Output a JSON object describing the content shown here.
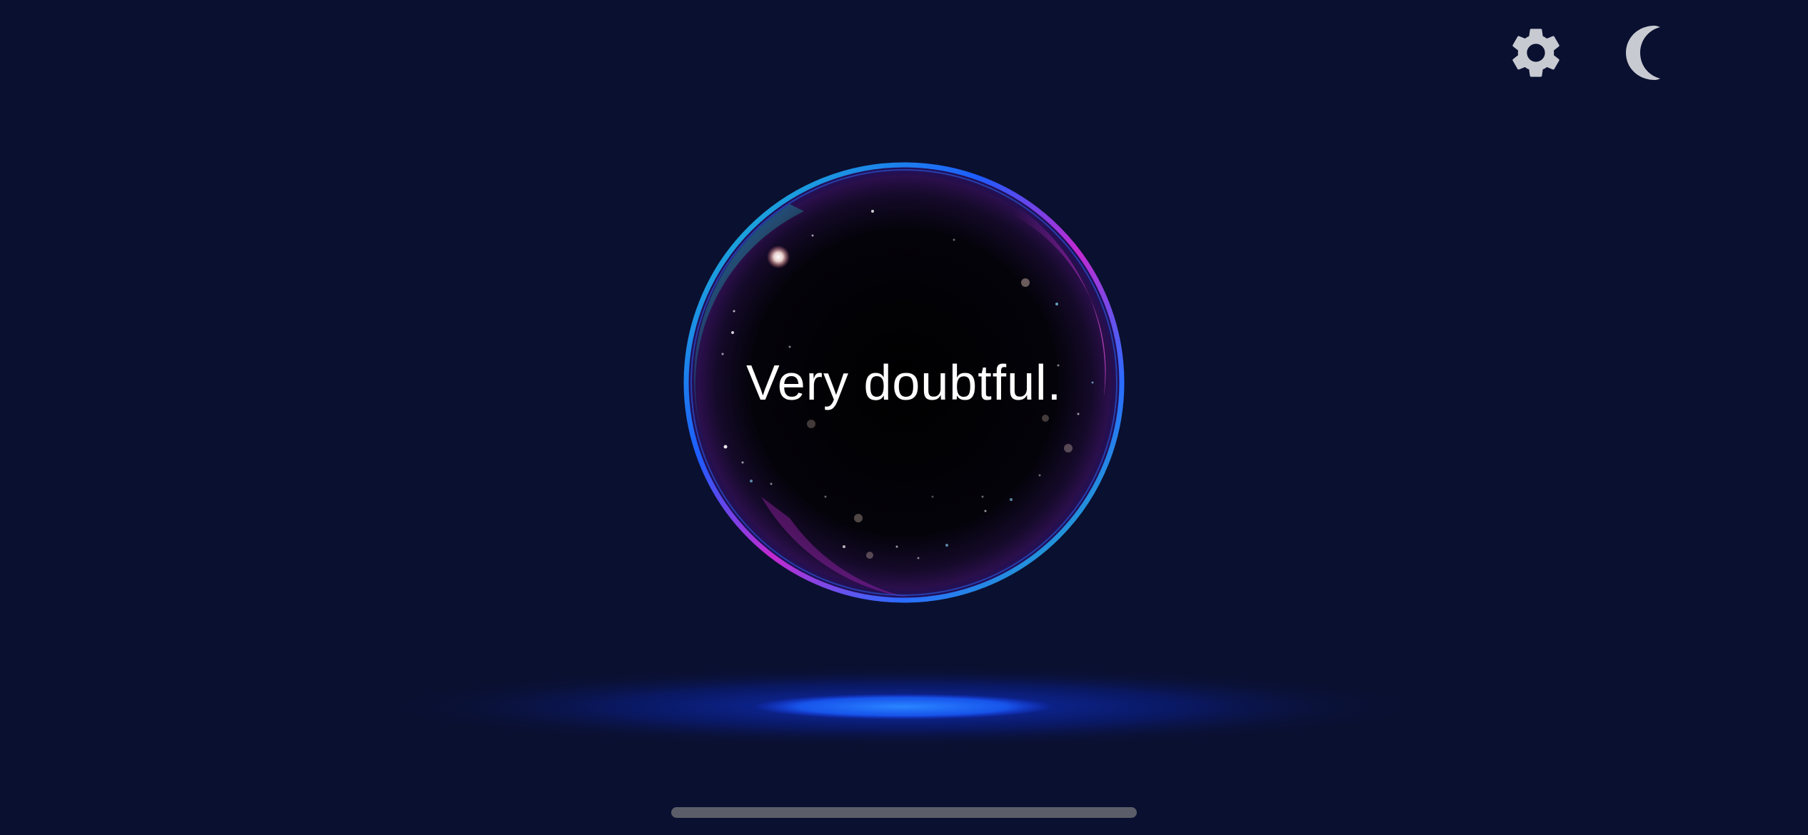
{
  "answer": {
    "text": "Very doubtful."
  },
  "toolbar": {
    "settings_icon": "gear-icon",
    "theme_icon": "moon-icon"
  },
  "colors": {
    "background": "#0a1030",
    "orb_rim_teal": "#19c7c0",
    "orb_rim_magenta": "#c02ccf",
    "orb_rim_blue": "#1e5cff",
    "glow_blue": "#1a6dff",
    "icon_gray": "#c8cad2"
  }
}
